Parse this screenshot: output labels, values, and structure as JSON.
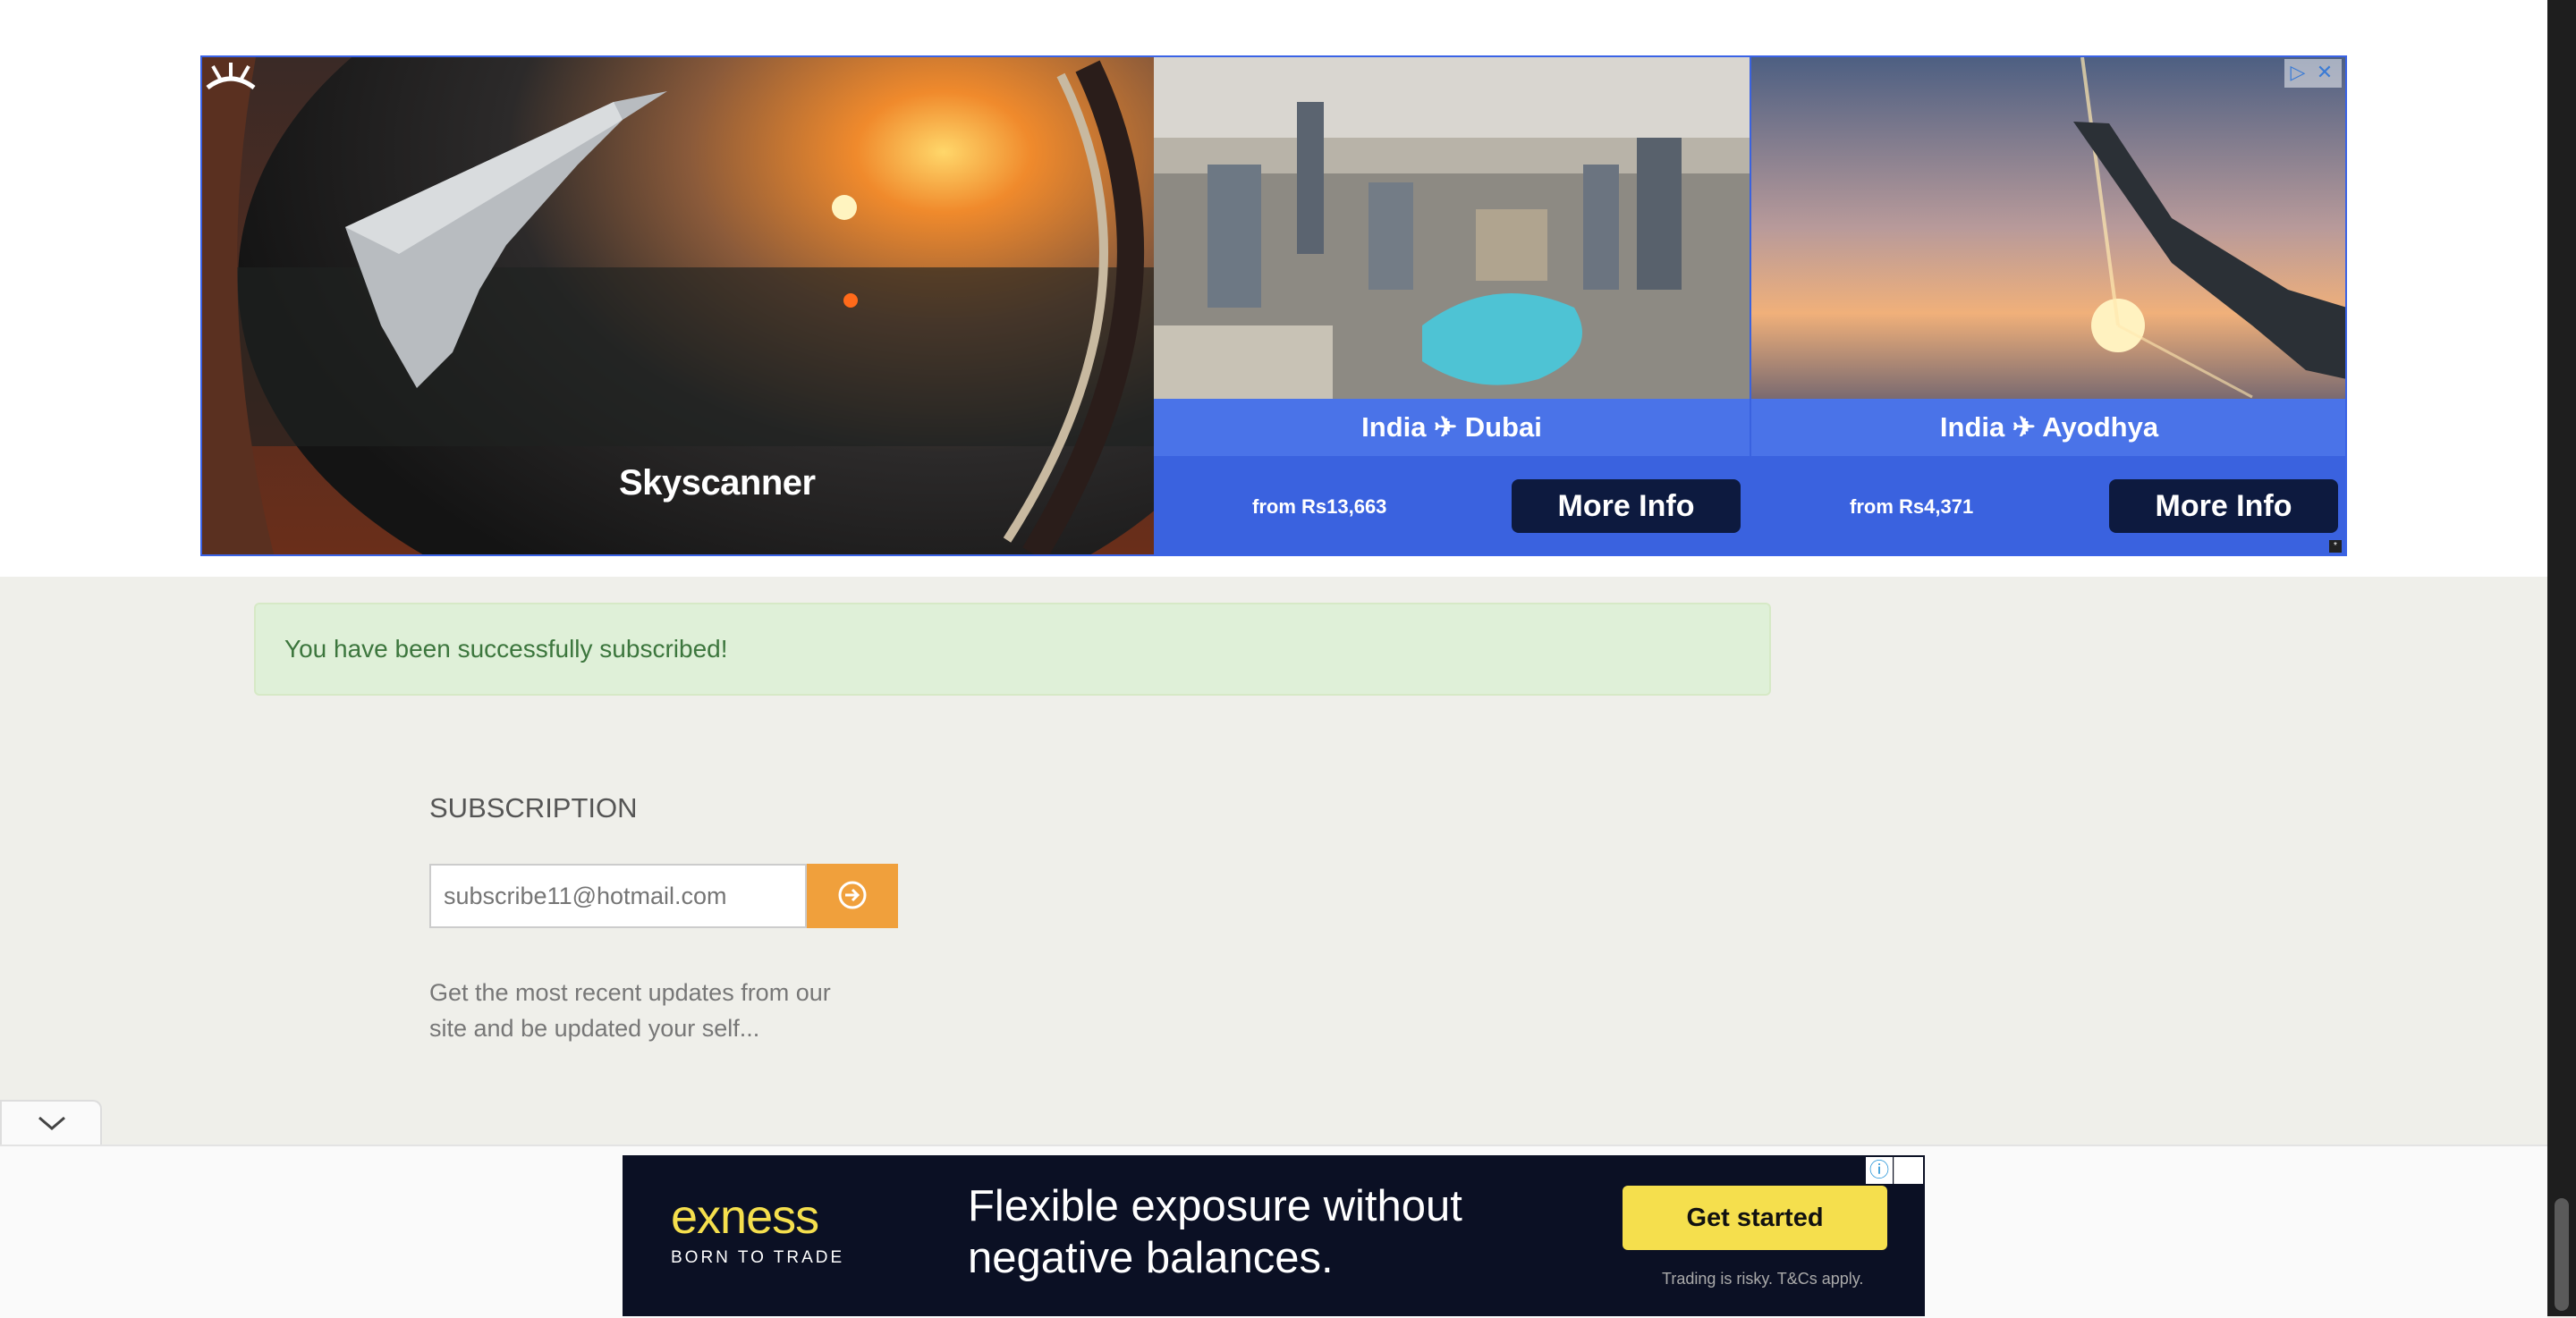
{
  "top_ad": {
    "brand": "Skyscanner",
    "panels": [
      {
        "destination": "India ✈ Dubai",
        "price": "from Rs13,663",
        "cta": "More Info"
      },
      {
        "destination": "India ✈ Ayodhya",
        "price": "from Rs4,371",
        "cta": "More Info"
      }
    ]
  },
  "alert": {
    "message": "You have been successfully subscribed!"
  },
  "subscription": {
    "title": "SUBSCRIPTION",
    "email_placeholder": "subscribe11@hotmail.com",
    "description": "Get the most recent updates from our site and be updated your self..."
  },
  "bottom_ad": {
    "logo": "exness",
    "tagline": "BORN TO TRADE",
    "headline": "Flexible exposure without negative balances.",
    "cta": "Get started",
    "disclaimer": "Trading is risky. T&Cs apply."
  },
  "colors": {
    "accent": "#f0a03c",
    "ad_blue": "#3a62df",
    "success_bg": "#dff0d8",
    "exness_yellow": "#f5df4d"
  }
}
